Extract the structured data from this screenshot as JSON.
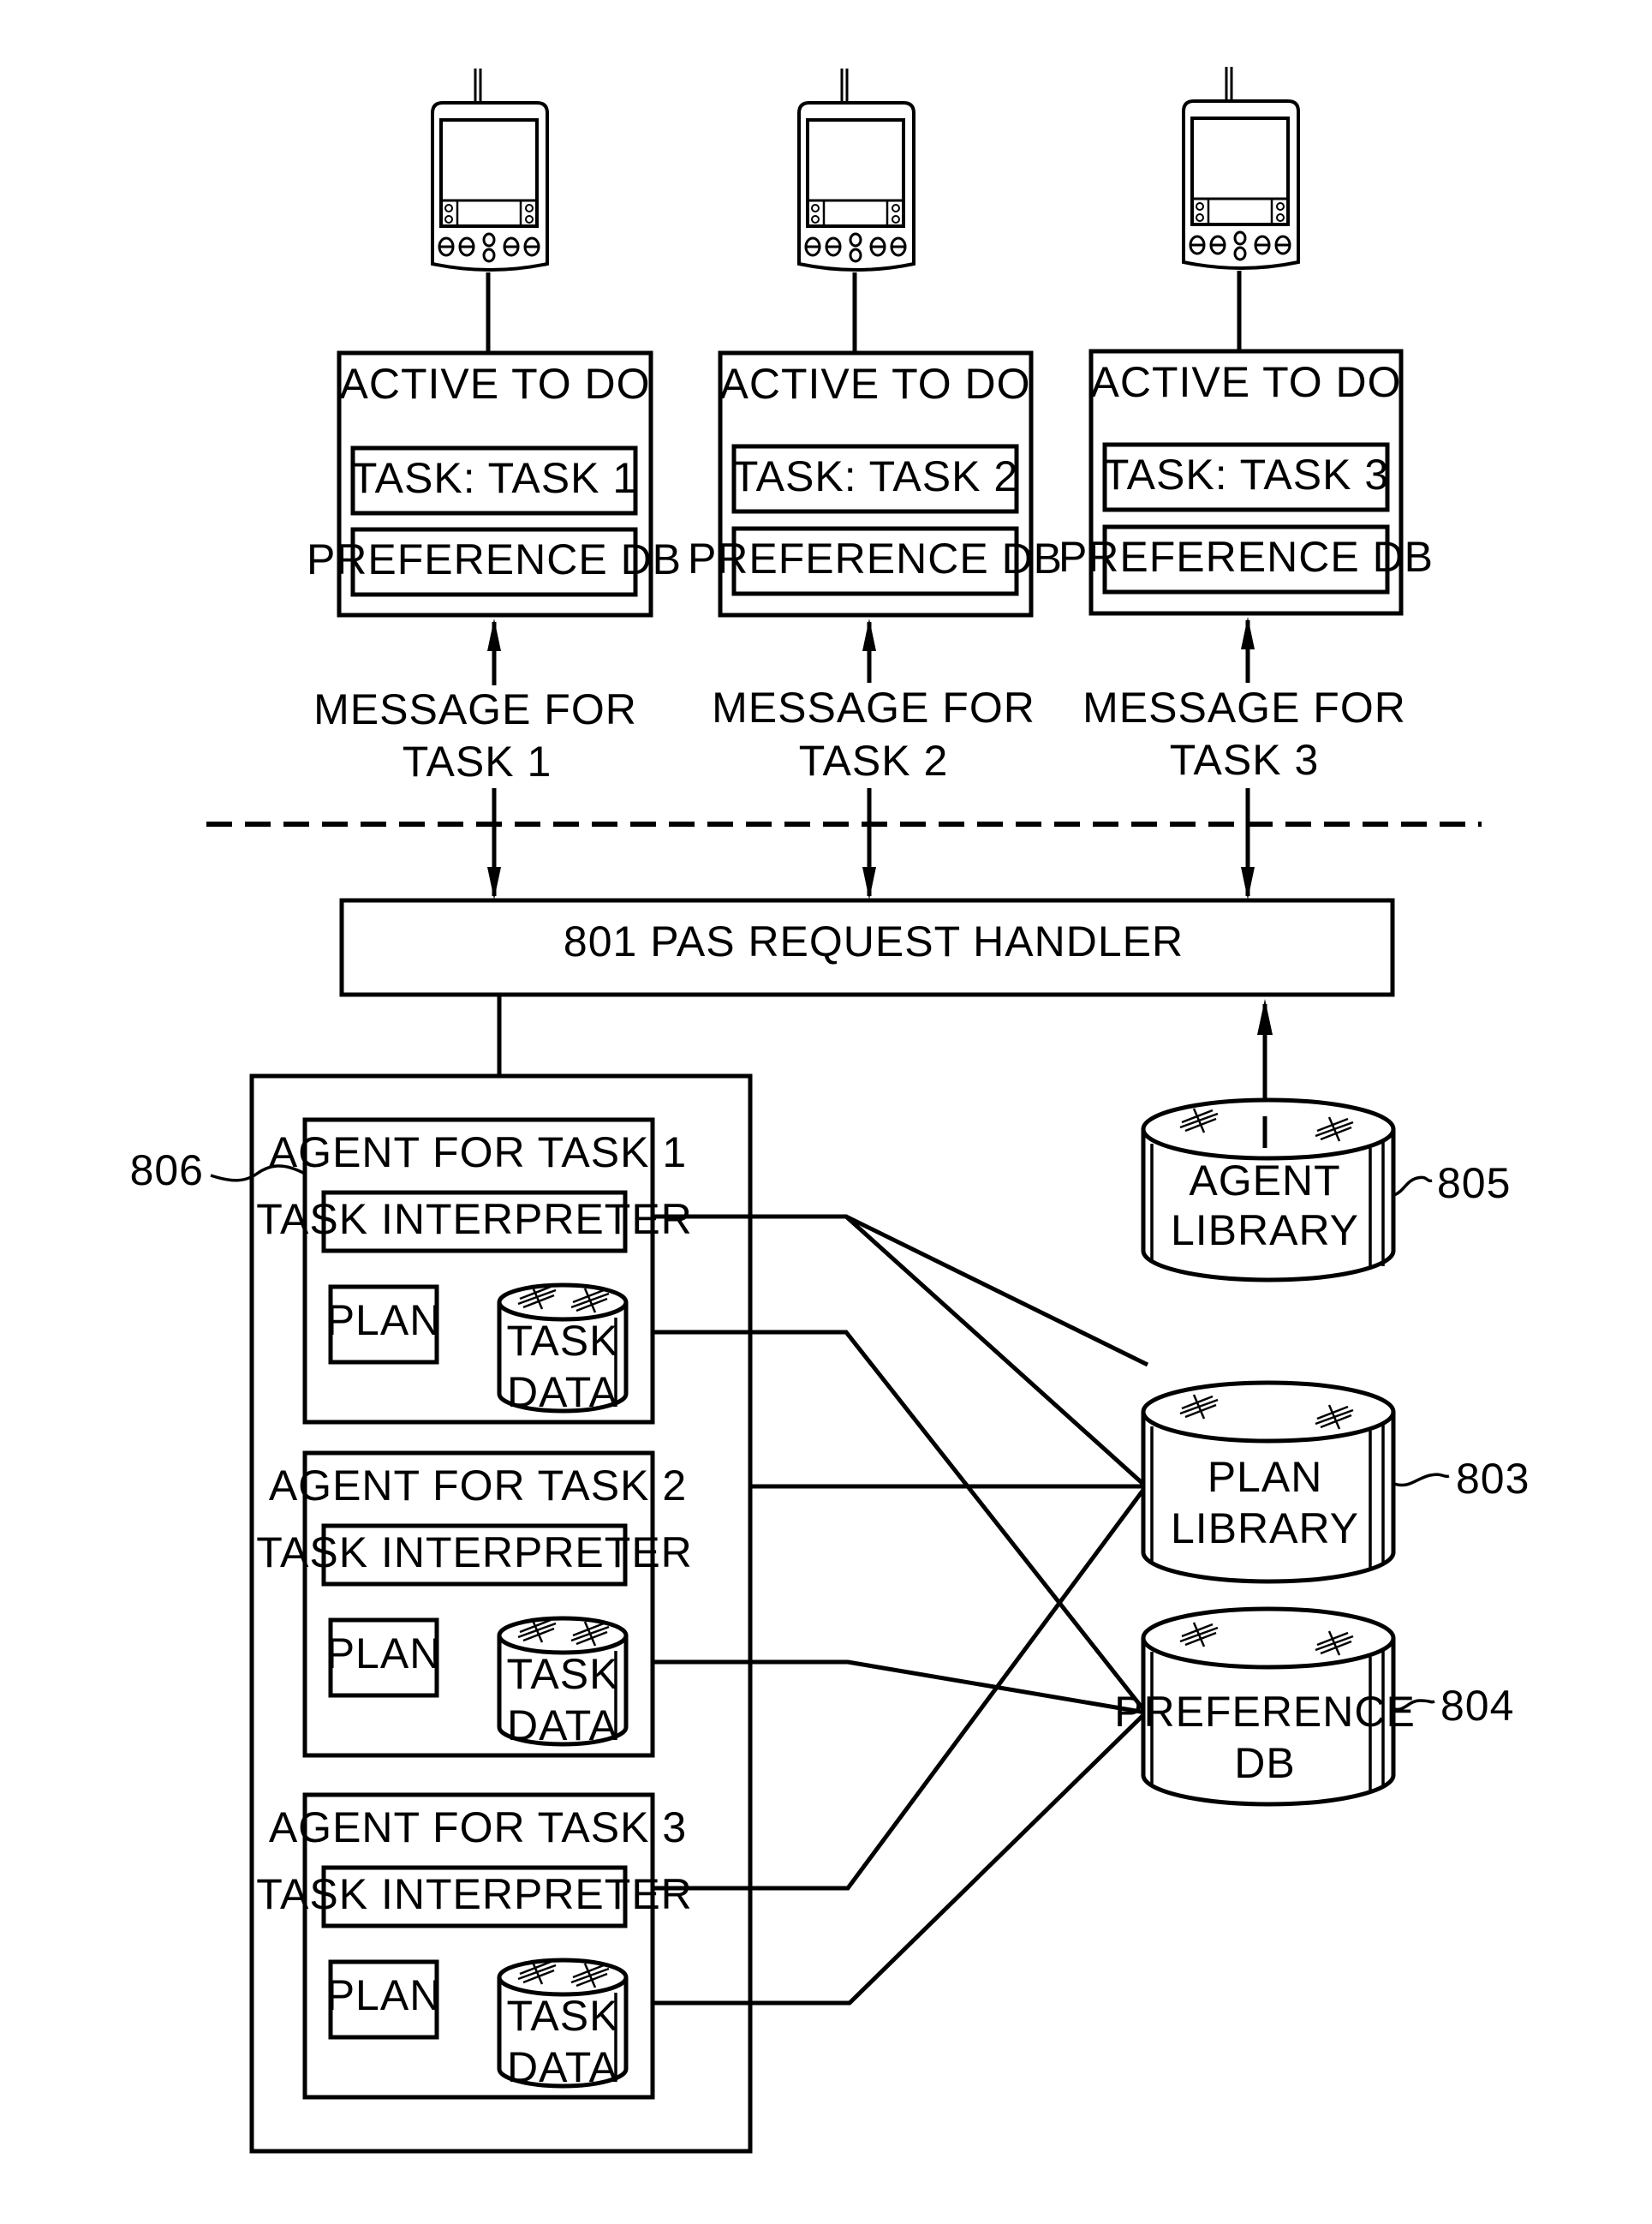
{
  "figure": {
    "colors": {
      "ink": "#000000",
      "paper": "#ffffff"
    },
    "clients": [
      {
        "device_icon": "pda-handheld-icon",
        "title": "ACTIVE TO DO",
        "task_label": "TASK: TASK 1",
        "pref_label": "PREFERENCE DB",
        "message_line1": "MESSAGE FOR",
        "message_line2": "TASK 1"
      },
      {
        "device_icon": "pda-handheld-icon",
        "title": "ACTIVE TO DO",
        "task_label": "TASK: TASK 2",
        "pref_label": "PREFERENCE DB",
        "message_line1": "MESSAGE FOR",
        "message_line2": "TASK 2"
      },
      {
        "device_icon": "pda-handheld-icon",
        "title": "ACTIVE TO DO",
        "task_label": "TASK: TASK 3",
        "pref_label": "PREFERENCE DB",
        "message_line1": "MESSAGE FOR",
        "message_line2": "TASK 3"
      }
    ],
    "request_handler": {
      "label": "801 PAS REQUEST HANDLER"
    },
    "agent_container": {
      "ref": "806"
    },
    "agents": [
      {
        "title": "AGENT FOR TASK 1",
        "interpreter": "TASK INTERPRETER",
        "plan": "PLAN",
        "data_line1": "TASK",
        "data_line2": "DATA"
      },
      {
        "title": "AGENT FOR TASK 2",
        "interpreter": "TASK INTERPRETER",
        "plan": "PLAN",
        "data_line1": "TASK",
        "data_line2": "DATA"
      },
      {
        "title": "AGENT FOR TASK 3",
        "interpreter": "TASK INTERPRETER",
        "plan": "PLAN",
        "data_line1": "TASK",
        "data_line2": "DATA"
      }
    ],
    "databases": {
      "agent_library": {
        "line1": "AGENT",
        "line2": "LIBRARY",
        "ref": "805"
      },
      "plan_library": {
        "line1": "PLAN",
        "line2": "LIBRARY",
        "ref": "803"
      },
      "preference_db": {
        "line1": "PREFERENCE",
        "line2": "DB",
        "ref": "804"
      }
    },
    "connections": [
      {
        "from": "agent-1-task-interpreter",
        "to": "plan-library"
      },
      {
        "from": "agent-1-task-data",
        "to": "preference-db"
      },
      {
        "from": "agent-container",
        "to": "plan-library"
      },
      {
        "from": "agent-2-task-data",
        "to": "preference-db"
      },
      {
        "from": "agent-3-task-interpreter",
        "to": "plan-library"
      },
      {
        "from": "agent-3-task-data",
        "to": "preference-db"
      },
      {
        "from": "agent-library",
        "to": "request-handler"
      },
      {
        "from": "request-handler",
        "to": "agent-container"
      }
    ],
    "boundary": "dashed-network-boundary"
  }
}
